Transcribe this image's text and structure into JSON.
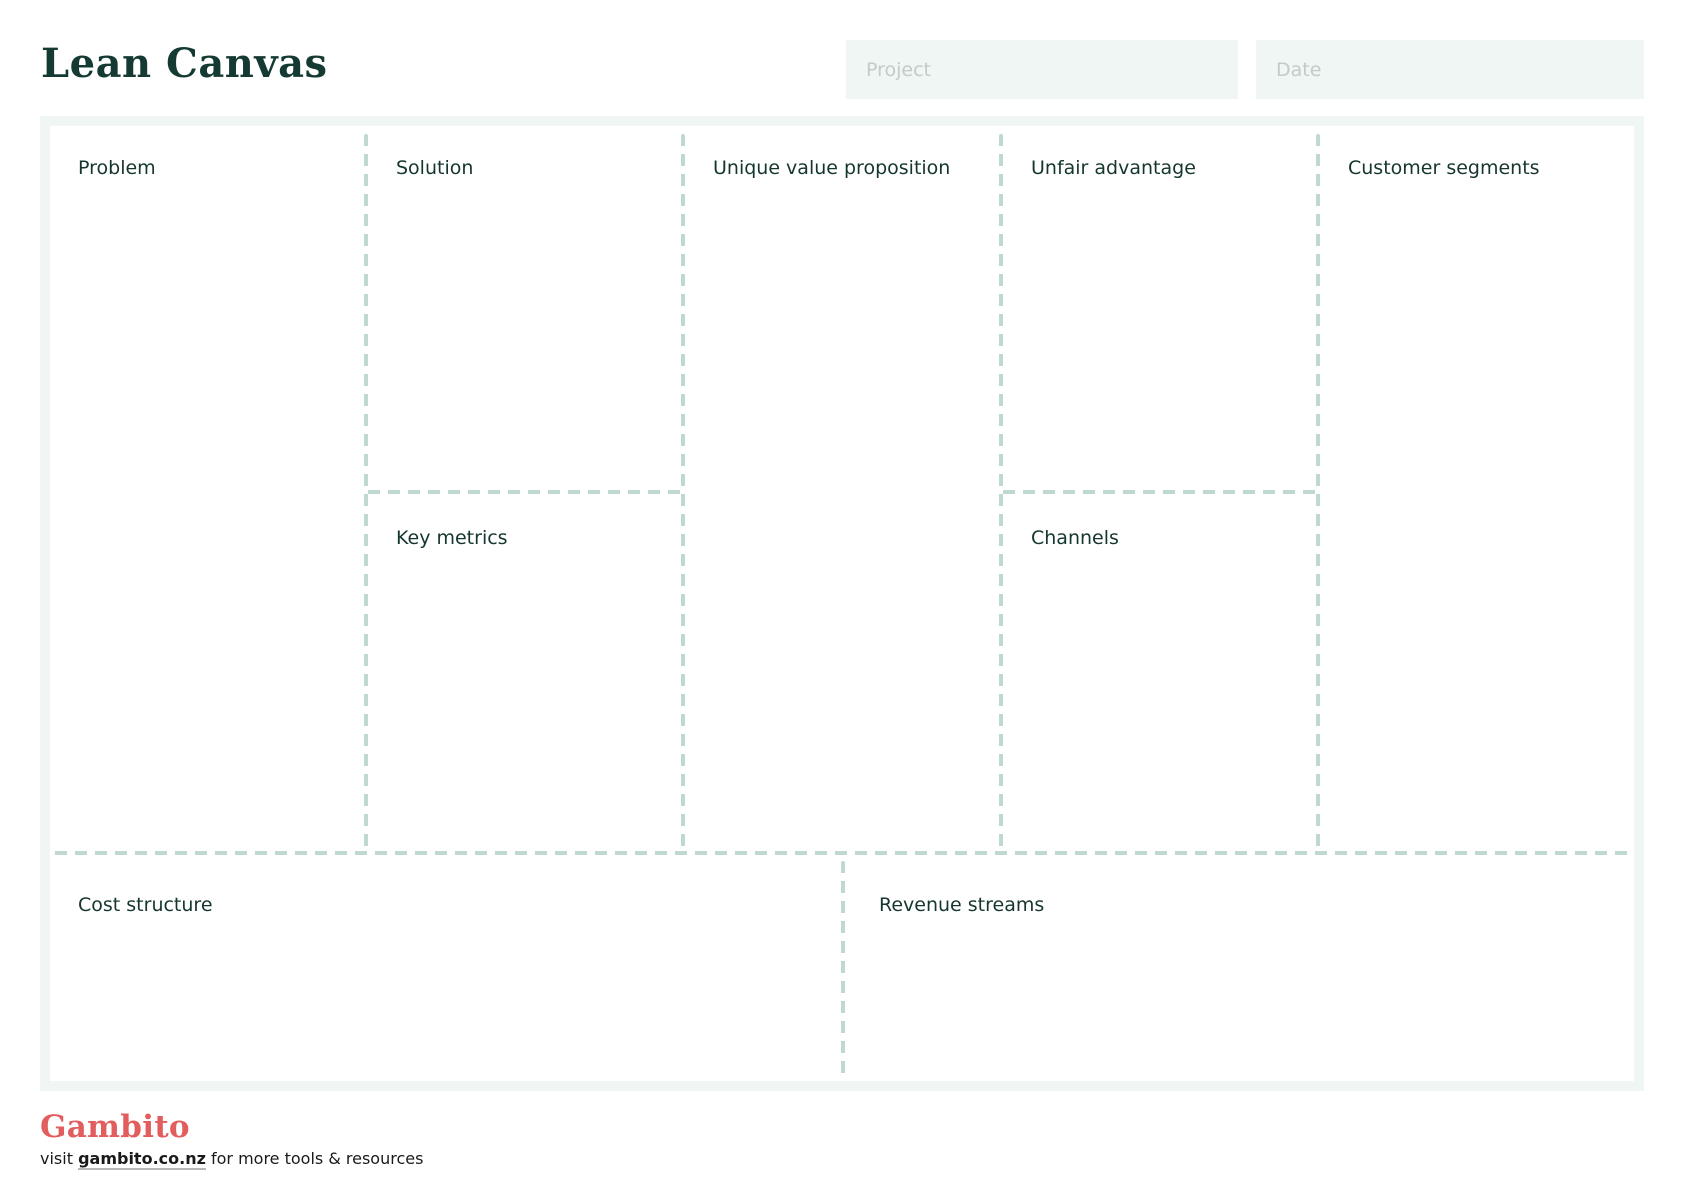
{
  "header": {
    "title": "Lean Canvas",
    "project_placeholder": "Project",
    "project_value": "",
    "date_placeholder": "Date",
    "date_value": ""
  },
  "canvas": {
    "sections": {
      "problem": "Problem",
      "solution": "Solution",
      "unique_value_proposition": "Unique value proposition",
      "unfair_advantage": "Unfair advantage",
      "customer_segments": "Customer segments",
      "key_metrics": "Key metrics",
      "channels": "Channels",
      "cost_structure": "Cost structure",
      "revenue_streams": "Revenue streams"
    }
  },
  "footer": {
    "brand": "Gambito",
    "prefix": "visit ",
    "link_text": "gambito.co.nz",
    "suffix": " for more tools & resources"
  },
  "colors": {
    "text": "#15362f",
    "frame": "#f0f6f4",
    "divider": "#bfd9d0",
    "brand": "#e25e5e"
  }
}
